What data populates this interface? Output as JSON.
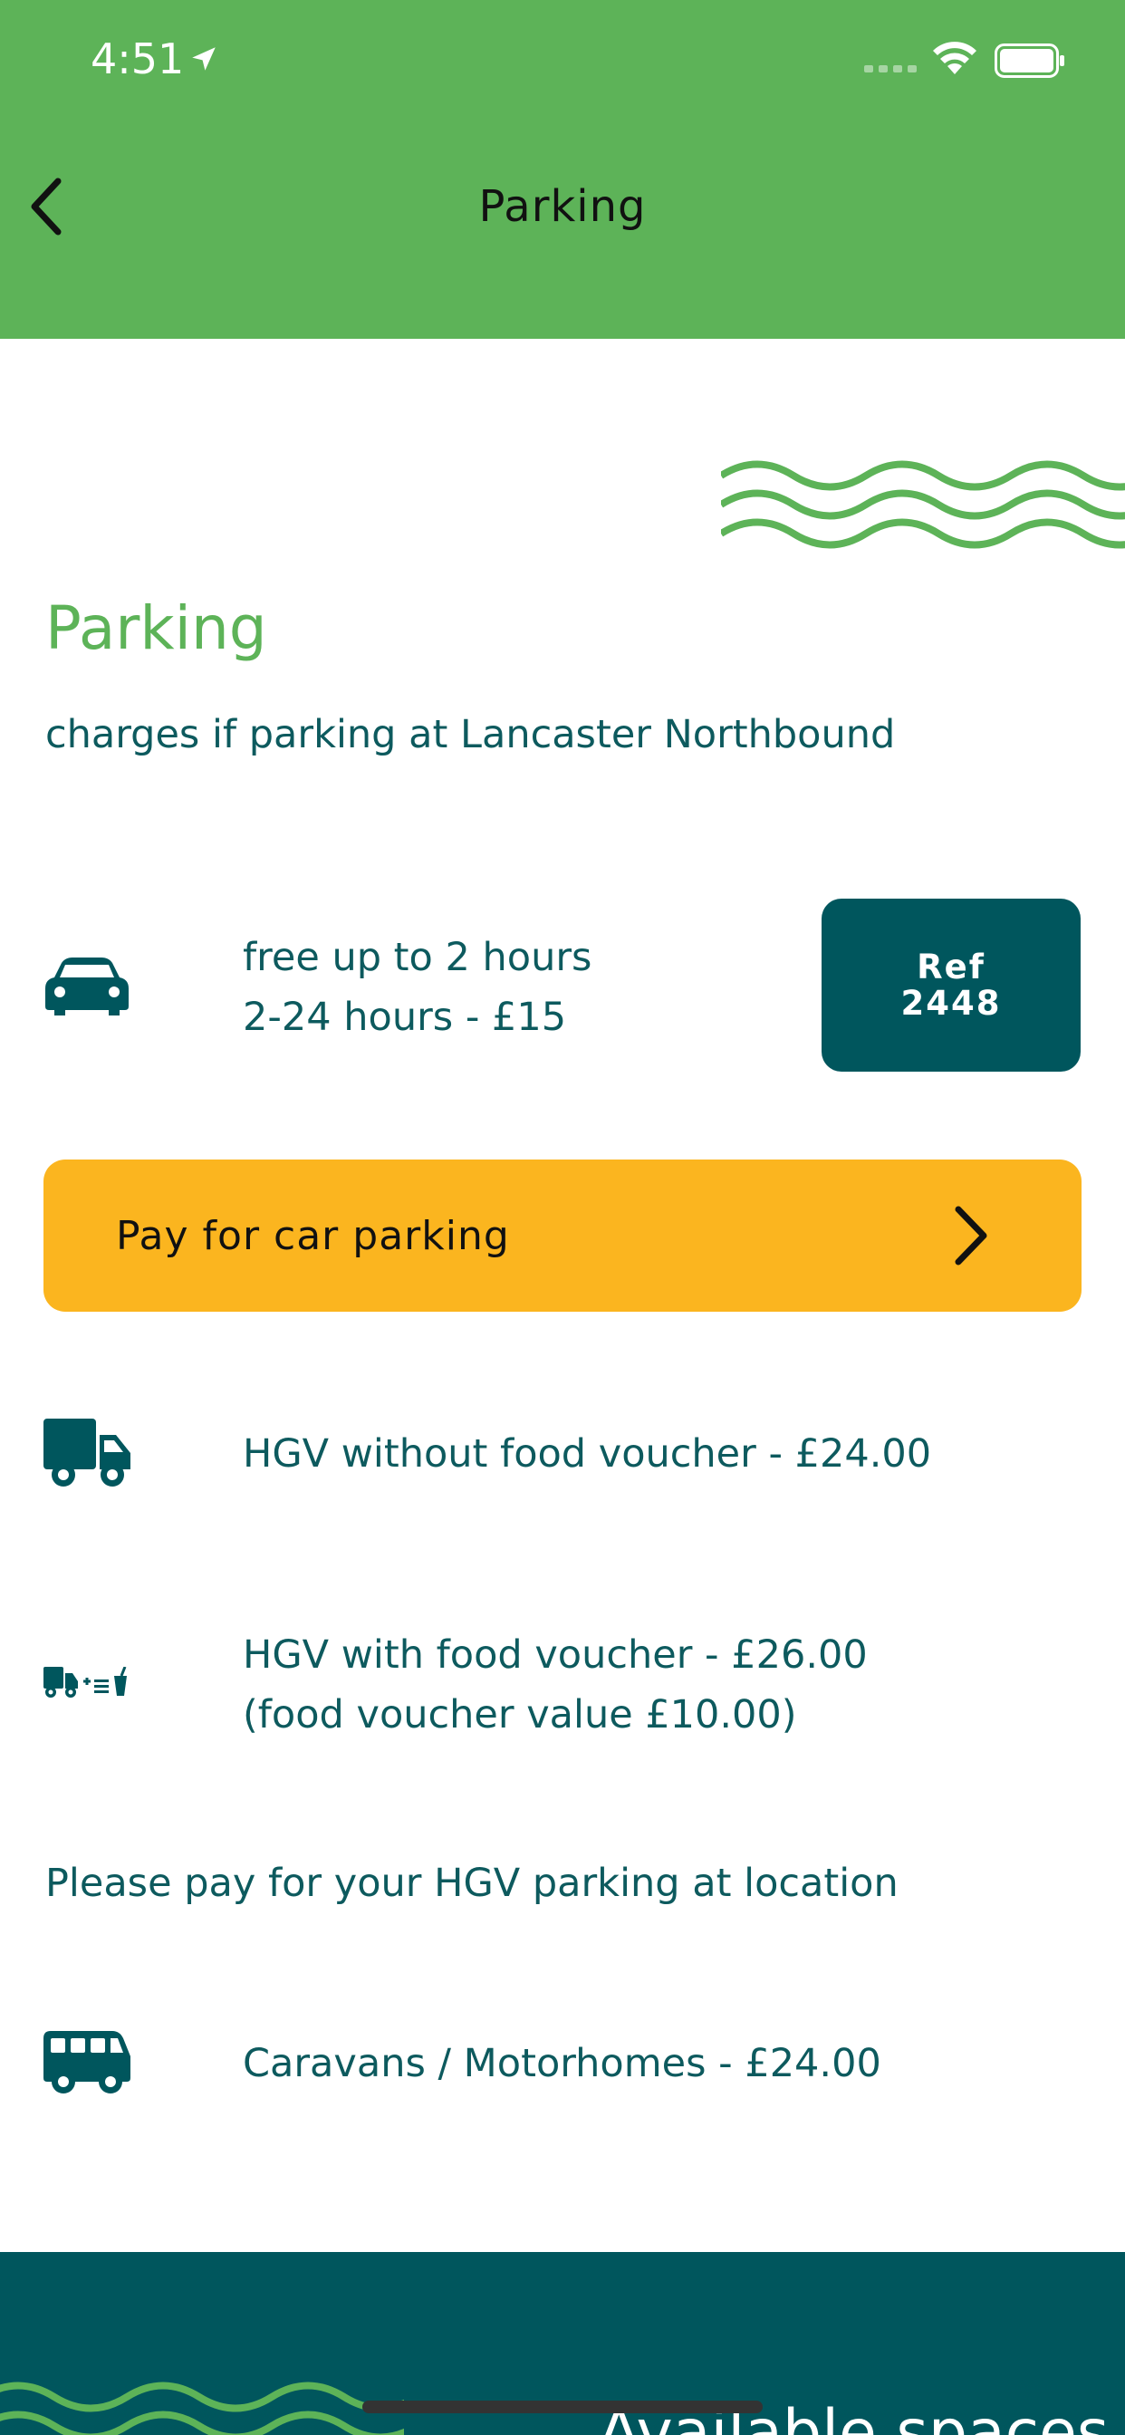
{
  "status_bar": {
    "time": "4:51"
  },
  "nav": {
    "title": "Parking"
  },
  "section": {
    "title": "Parking",
    "subtitle": "charges if parking at Lancaster Northbound"
  },
  "car": {
    "line1": "free up to 2 hours",
    "line2": "2-24 hours - £15",
    "ref_label": "Ref",
    "ref_number": "2448"
  },
  "pay_button": {
    "label": "Pay for car parking"
  },
  "hgv_no_food": {
    "text": "HGV without food voucher - £24.00"
  },
  "hgv_food": {
    "line1": "HGV with food voucher - £26.00",
    "line2": "(food voucher value £10.00)"
  },
  "hgv_note": "Please pay for your HGV parking at location",
  "caravan": {
    "text": "Caravans / Motorhomes - £24.00"
  },
  "footer": {
    "text": "Available spaces"
  },
  "colors": {
    "header_green": "#5db358",
    "teal": "#00565d",
    "text_teal": "#0d5a5e",
    "pay_yellow": "#fbb51f"
  }
}
